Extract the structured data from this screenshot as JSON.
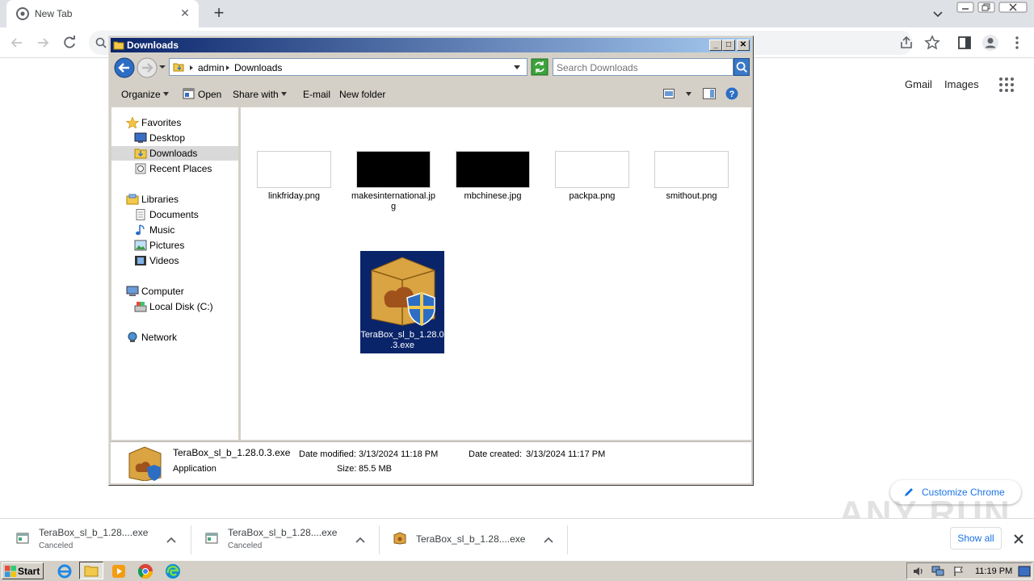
{
  "browser": {
    "tab_title": "New Tab",
    "ntp": {
      "gmail": "Gmail",
      "images": "Images",
      "customize_label": "Customize Chrome"
    },
    "watermark": "ANY RUN"
  },
  "downloads_shelf": {
    "items": [
      {
        "name": "TeraBox_sl_b_1.28....exe",
        "status": "Canceled"
      },
      {
        "name": "TeraBox_sl_b_1.28....exe",
        "status": "Canceled"
      },
      {
        "name": "TeraBox_sl_b_1.28....exe",
        "status": ""
      }
    ],
    "show_all": "Show all"
  },
  "explorer": {
    "title": "Downloads",
    "breadcrumb": [
      "admin",
      "Downloads"
    ],
    "search_placeholder": "Search Downloads",
    "commands": {
      "organize": "Organize",
      "open": "Open",
      "share_with": "Share with",
      "email": "E-mail",
      "new_folder": "New folder"
    },
    "nav": {
      "favorites": "Favorites",
      "desktop": "Desktop",
      "downloads": "Downloads",
      "recent_places": "Recent Places",
      "libraries": "Libraries",
      "documents": "Documents",
      "music": "Music",
      "pictures": "Pictures",
      "videos": "Videos",
      "computer": "Computer",
      "local_disk": "Local Disk (C:)",
      "network": "Network"
    },
    "files": [
      {
        "name": "linkfriday.png"
      },
      {
        "name": "makesinternational.jpg"
      },
      {
        "name": "mbchinese.jpg"
      },
      {
        "name": "packpa.png"
      },
      {
        "name": "smithout.png"
      },
      {
        "name": "TeraBox_sl_b_1.28.0.3.exe"
      }
    ],
    "details": {
      "name": "TeraBox_sl_b_1.28.0.3.exe",
      "type": "Application",
      "modified_label": "Date modified:",
      "modified_value": "3/13/2024 11:18 PM",
      "created_label": "Date created:",
      "created_value": "3/13/2024 11:17 PM",
      "size_label": "Size:",
      "size_value": "85.5 MB"
    }
  },
  "taskbar": {
    "start": "Start",
    "clock": "11:19 PM"
  },
  "colors": {
    "title_bar": "#0a246a",
    "selection": "#0a246a",
    "chrome_blue": "#1a73e8",
    "taskbar": "#d4d0c8"
  }
}
